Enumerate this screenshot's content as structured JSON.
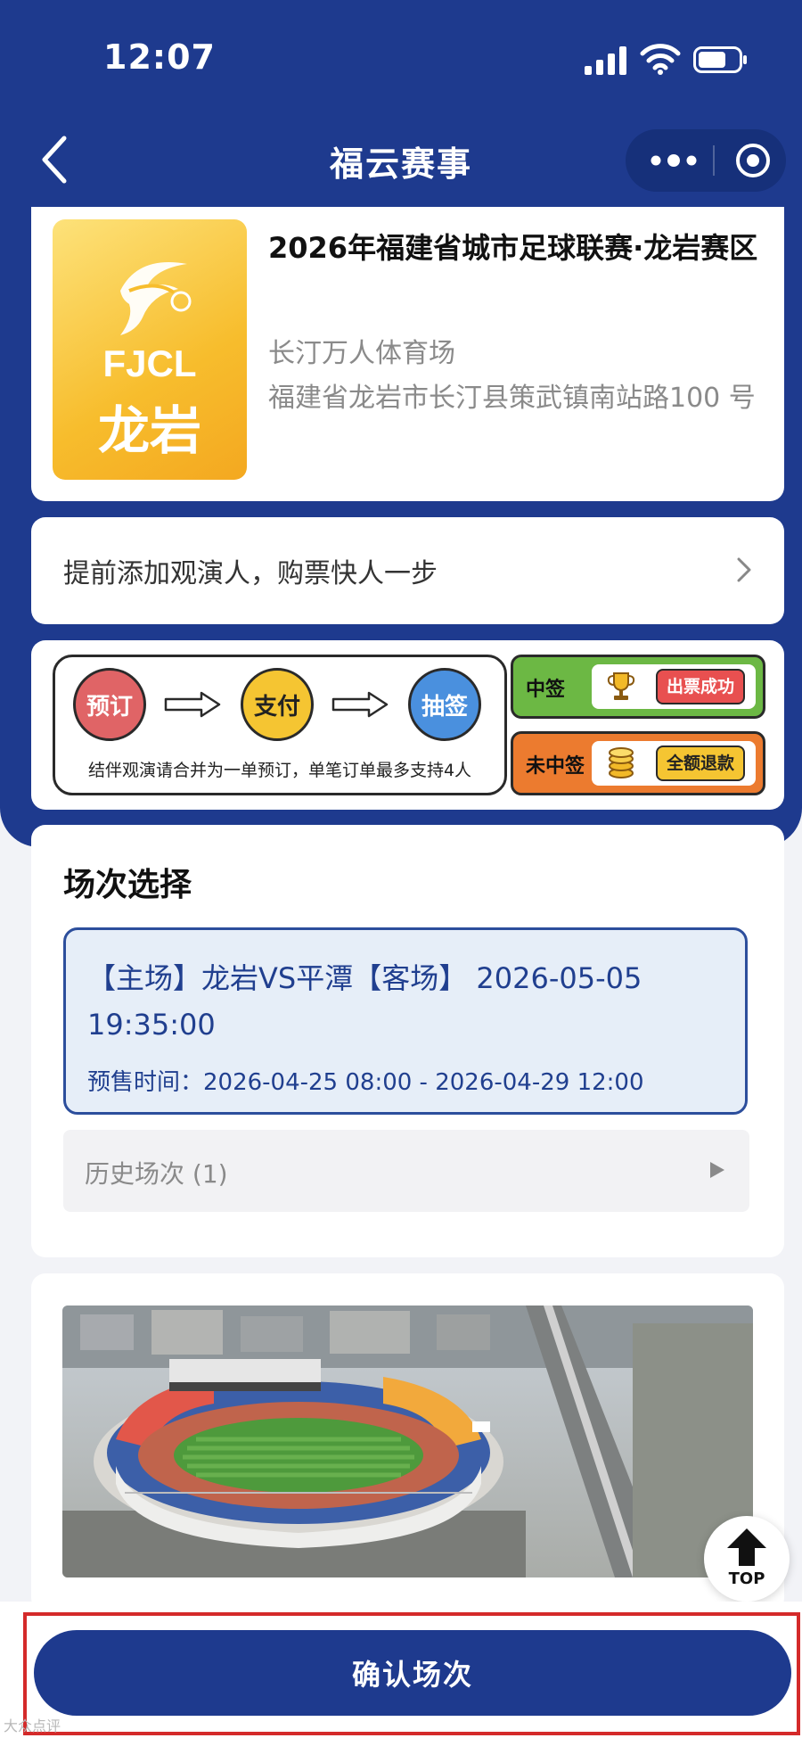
{
  "status_bar": {
    "time": "12:07"
  },
  "nav": {
    "title": "福云赛事"
  },
  "event": {
    "poster_brand": "FJCL",
    "poster_city": "龙岩",
    "title": "2026年福建省城市足球联赛·龙岩赛区",
    "venue_name": "长汀万人体育场",
    "venue_address": "福建省龙岩市长汀县策武镇南站路100 号"
  },
  "add_viewer": {
    "text": "提前添加观演人，购票快人一步"
  },
  "flow": {
    "steps": [
      "预订",
      "支付",
      "抽签"
    ],
    "note": "结伴观演请合并为一单预订，单笔订单最多支持4人",
    "win": {
      "label": "中签",
      "result": "出票成功"
    },
    "lose": {
      "label": "未中签",
      "result": "全额退款"
    }
  },
  "session": {
    "heading": "场次选择",
    "match_title": "【主场】龙岩VS平潭【客场】 2026-05-05 19:35:00",
    "presale": "预售时间：2026-04-25 08:00 - 2026-04-29 12:00",
    "history": "历史场次 (1)"
  },
  "top_button": {
    "label": "TOP"
  },
  "confirm": {
    "label": "确认场次"
  },
  "watermark": "大众点评",
  "colors": {
    "brand_blue": "#1e3a8e",
    "selected_bg": "#e6eef8",
    "selected_border": "#2c4e9c",
    "highlight_red": "#d42a2a"
  }
}
